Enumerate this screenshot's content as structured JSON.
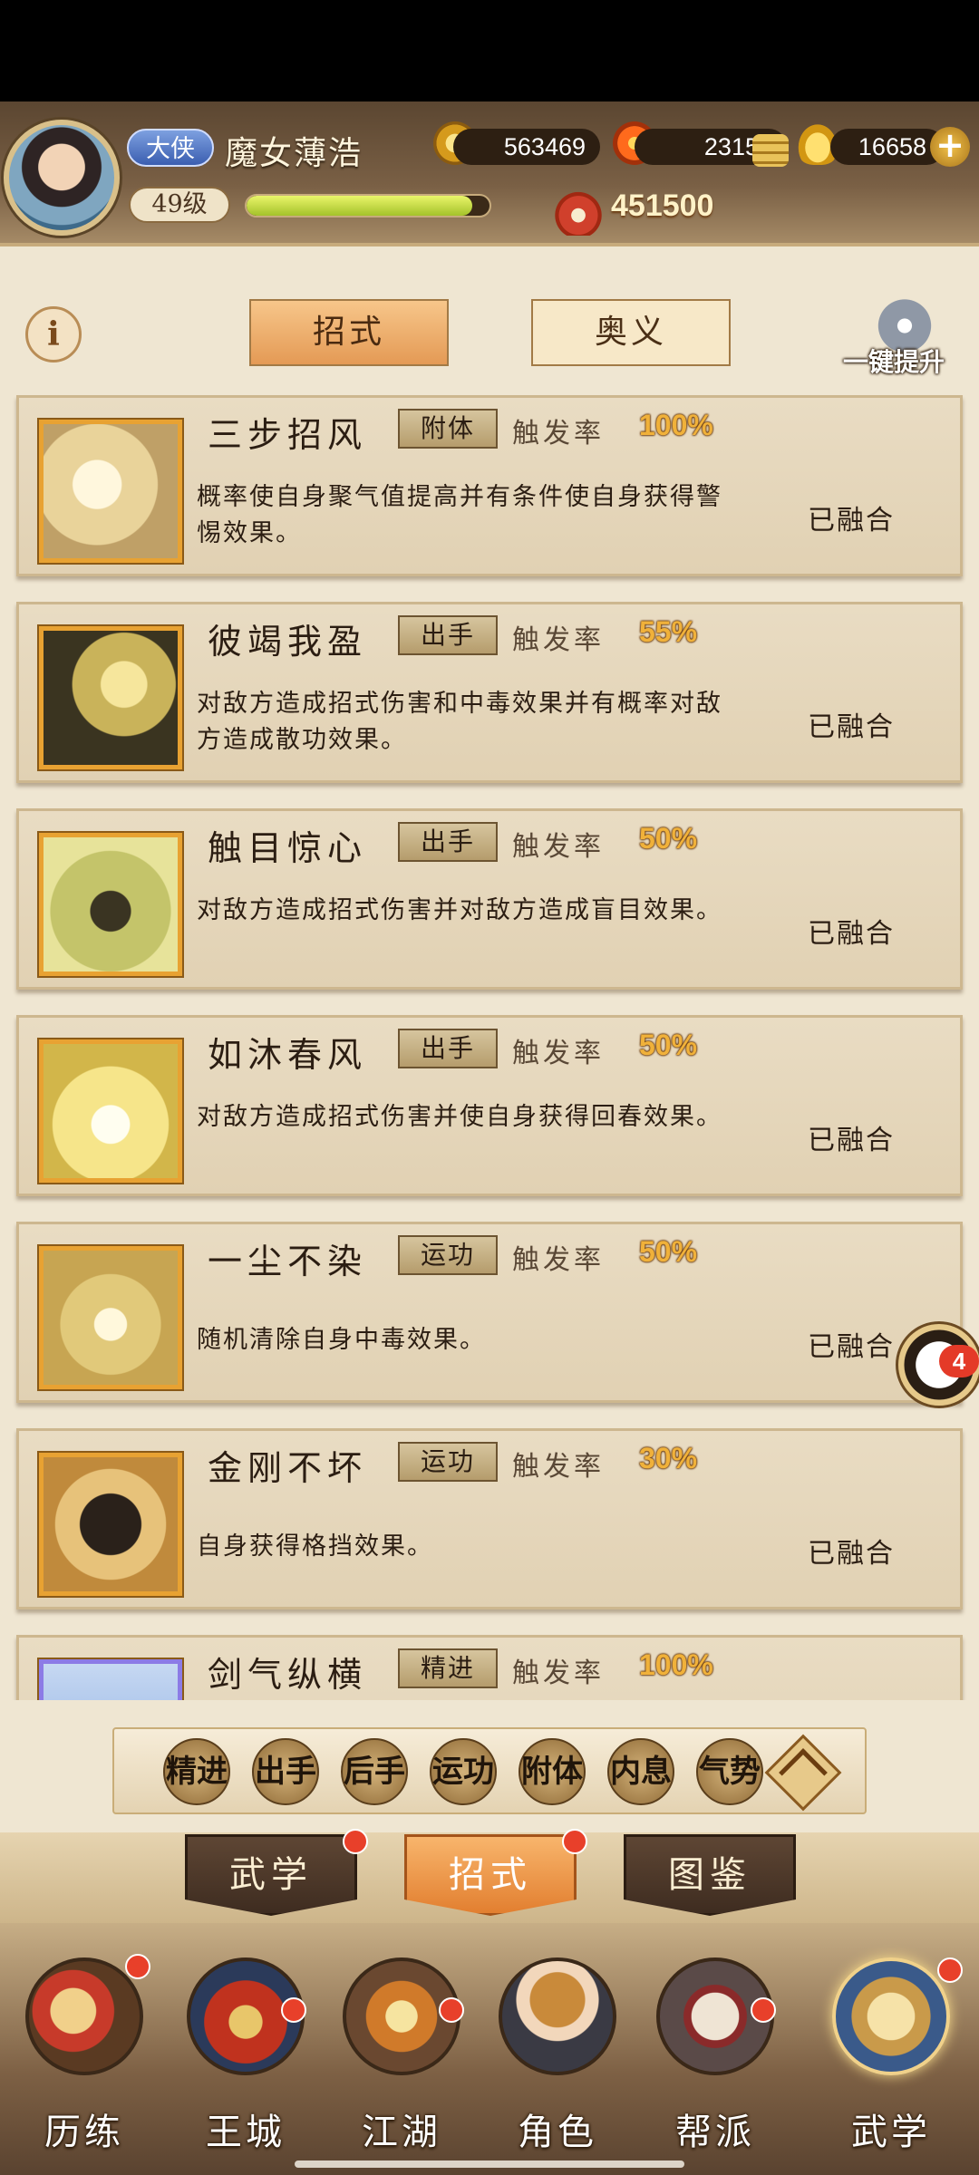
{
  "header": {
    "rank_badge": "大侠",
    "player_name": "魔女薄浩",
    "level": "49级",
    "exp_fraction": 0.93,
    "coins": "563469",
    "fire_currency": "23153",
    "gold_ingots": "16658",
    "power": "451500"
  },
  "top_tabs": {
    "active": "招式",
    "inactive": "奥义",
    "upgrade_label": "一键提升"
  },
  "trigger_label": "触发率",
  "skills": [
    {
      "name": "三步招风",
      "type": "附体",
      "rate": "100%",
      "desc": "概率使自身聚气值提高并有条件使自身获得警惕效果。",
      "status": "已融合"
    },
    {
      "name": "彼竭我盈",
      "type": "出手",
      "rate": "55%",
      "desc": "对敌方造成招式伤害和中毒效果并有概率对敌方造成散功效果。",
      "status": "已融合"
    },
    {
      "name": "触目惊心",
      "type": "出手",
      "rate": "50%",
      "desc": "对敌方造成招式伤害并对敌方造成盲目效果。",
      "status": "已融合"
    },
    {
      "name": "如沐春风",
      "type": "出手",
      "rate": "50%",
      "desc": "对敌方造成招式伤害并使自身获得回春效果。",
      "status": "已融合"
    },
    {
      "name": "一尘不染",
      "type": "运功",
      "rate": "50%",
      "desc": "随机清除自身中毒效果。",
      "status": "已融合"
    },
    {
      "name": "金刚不坏",
      "type": "运功",
      "rate": "30%",
      "desc": "自身获得格挡效果。",
      "status": "已融合"
    },
    {
      "name": "剑气纵横",
      "type": "精进",
      "rate": "100%",
      "desc": "",
      "status": ""
    }
  ],
  "chat_badge": "4",
  "filters": [
    "精进",
    "出手",
    "后手",
    "运功",
    "附体",
    "内息",
    "气势"
  ],
  "sub_tabs": [
    "武学",
    "招式",
    "图鉴"
  ],
  "bottom_nav": [
    "历练",
    "王城",
    "江湖",
    "角色",
    "帮派",
    "武学"
  ],
  "colors": {
    "accent_orange": "#e49a55",
    "rate_gold": "#f0b13a",
    "notification_red": "#e8402a"
  }
}
